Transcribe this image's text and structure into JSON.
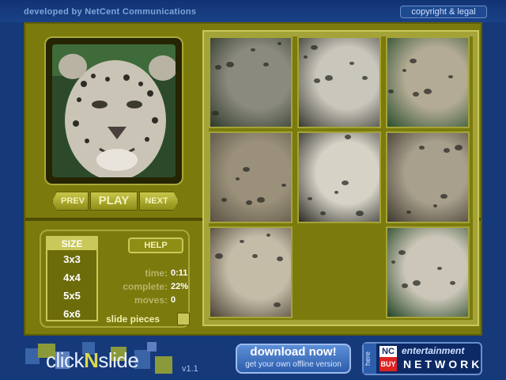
{
  "header": {
    "developer_text": "developed by NetCent Communications",
    "copyright_label": "copyright & legal"
  },
  "preview": {
    "image_subject": "snow leopard face"
  },
  "navigation": {
    "prev_label": "PREV",
    "play_label": "PLAY",
    "next_label": "NEXT"
  },
  "size_panel": {
    "title": "SIZE",
    "options": [
      "3x3",
      "4x4",
      "5x5",
      "6x6"
    ]
  },
  "help_label": "HELP",
  "stats": {
    "time_label": "time:",
    "time_value": "0:11",
    "complete_label": "complete:",
    "complete_value": "22%",
    "moves_label": "moves:",
    "moves_value": "0"
  },
  "slide_pieces_label": "slide pieces",
  "puzzle": {
    "grid_size": 3,
    "empty_tile": 7,
    "tiles": [
      {
        "tone": "#8b8a7e",
        "accent": "#2f3a2a"
      },
      {
        "tone": "#c9c6bb",
        "accent": "#3a3a32"
      },
      {
        "tone": "#b3ab94",
        "accent": "#2c4f2c"
      },
      {
        "tone": "#9b917a",
        "accent": "#5a5244"
      },
      {
        "tone": "#d6d2c6",
        "accent": "#2b2b25"
      },
      {
        "tone": "#a89f8c",
        "accent": "#3f3a2f"
      },
      {
        "tone": "#c5bca8",
        "accent": "#4a4233"
      },
      {
        "tone": "#7b7a0d",
        "accent": "#7b7a0d"
      },
      {
        "tone": "#cbc6b8",
        "accent": "#234423"
      }
    ]
  },
  "footer": {
    "logo_text_before": "click",
    "logo_text_n": "N",
    "logo_text_after": "slide",
    "version": "v1.1",
    "download_title": "download now!",
    "download_subtitle": "get your own offline version",
    "here_label": "here",
    "nc_top": "NC",
    "nc_bottom": "BUY",
    "entertainment_label": "entertainment",
    "network_label": "NETWORK"
  },
  "colors": {
    "background": "#16397a",
    "board": "#7b7a0d",
    "accent": "#c9c85a"
  }
}
